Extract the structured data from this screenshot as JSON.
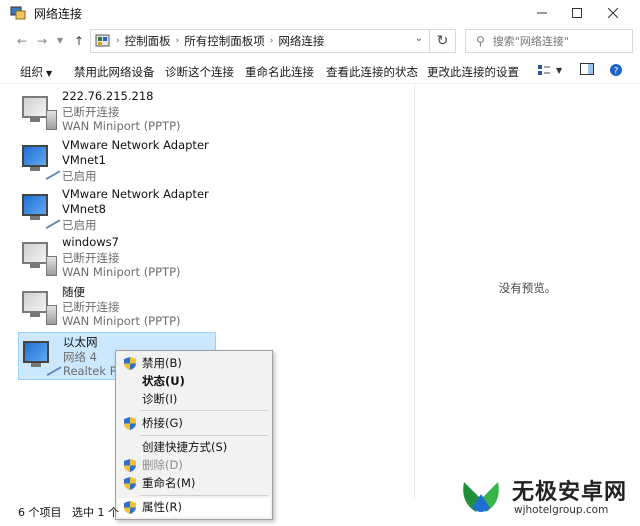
{
  "window": {
    "title": "网络连接"
  },
  "address": {
    "crumbs": [
      "控制面板",
      "所有控制面板项",
      "网络连接"
    ],
    "search_placeholder": "搜索\"网络连接\""
  },
  "toolbar": {
    "organize": "组织",
    "disable": "禁用此网络设备",
    "diagnose": "诊断这个连接",
    "rename": "重命名此连接",
    "view_status": "查看此连接的状态",
    "change_settings": "更改此连接的设置"
  },
  "connections": [
    {
      "name": "222.76.215.218",
      "status": "已断开连接",
      "device": "WAN Miniport (PPTP)",
      "icon": "dialup-icon"
    },
    {
      "name": "VMware Network Adapter",
      "status": "VMnet1",
      "device": "已启用",
      "icon": "ethernet-icon"
    },
    {
      "name": "VMware Network Adapter",
      "status": "VMnet8",
      "device": "已启用",
      "icon": "ethernet-icon"
    },
    {
      "name": "windows7",
      "status": "已断开连接",
      "device": "WAN Miniport (PPTP)",
      "icon": "dialup-icon"
    },
    {
      "name": "随便",
      "status": "已断开连接",
      "device": "WAN Miniport (PPTP)",
      "icon": "dialup-icon"
    },
    {
      "name": "以太网",
      "status": "网络 4",
      "device": "Realtek PCI",
      "icon": "ethernet-icon"
    }
  ],
  "preview": {
    "text": "没有预览。"
  },
  "context_menu": {
    "disable": "禁用(B)",
    "status": "状态(U)",
    "diagnose": "诊断(I)",
    "bridge": "桥接(G)",
    "shortcut": "创建快捷方式(S)",
    "delete": "删除(D)",
    "rename": "重命名(M)",
    "properties": "属性(R)"
  },
  "statusbar": {
    "count": "6 个项目",
    "selected": "选中 1 个"
  },
  "watermark": {
    "brand": "无极安卓网",
    "url": "wjhotelgroup.com"
  },
  "colors": {
    "selection": "#cce8ff",
    "accent": "#0078d7"
  }
}
